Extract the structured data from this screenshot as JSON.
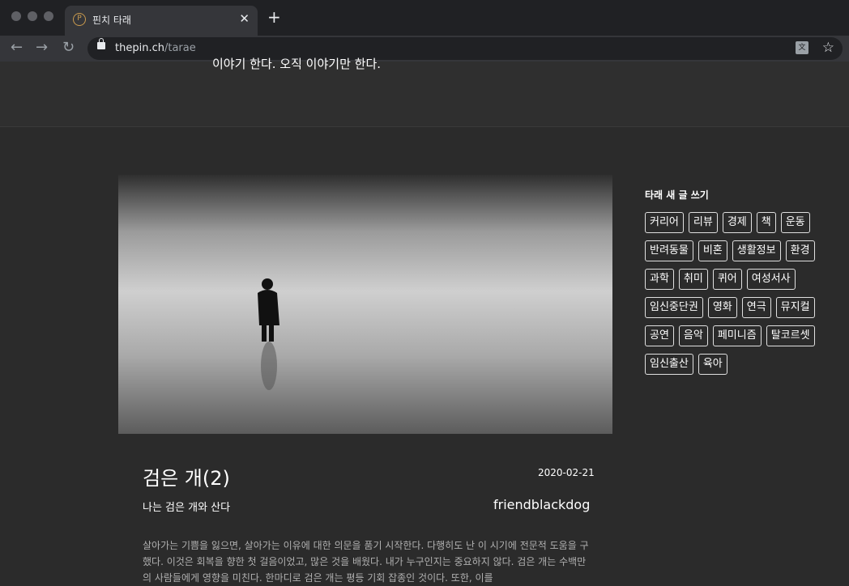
{
  "browser": {
    "tab_title": "핀치 타래",
    "favicon_letter": "P",
    "url_host": "thepin.ch",
    "url_path": "/tarae"
  },
  "header": {
    "cut_text": "이야기 한다. 오직 이야기만 한다."
  },
  "post": {
    "title": "검은 개(2)",
    "date": "2020-02-21",
    "subtitle": "나는 검은 개와 산다",
    "author": "friendblackdog",
    "body": "살아가는 기쁨을 잃으면, 살아가는 이유에 대한 의문을 품기 시작한다. 다행히도 난 이 시기에 전문적 도움을 구했다. 이것은 회복을 향한 첫 걸음이었고, 많은 것을 배웠다. 내가 누구인지는 중요하지 않다. 검은 개는 수백만의 사람들에게 영향을 미친다. 한마디로 검은 개는 평등 기회 잡종인 것이다. 또한, 이를"
  },
  "sidebar": {
    "heading": "타래 새 글 쓰기",
    "tags": [
      "커리어",
      "리뷰",
      "경제",
      "책",
      "운동",
      "반려동물",
      "비혼",
      "생활정보",
      "환경",
      "과학",
      "취미",
      "퀴어",
      "여성서사",
      "임신중단권",
      "영화",
      "연극",
      "뮤지컬",
      "공연",
      "음악",
      "페미니즘",
      "탈코르셋",
      "임신출산",
      "육아"
    ]
  }
}
